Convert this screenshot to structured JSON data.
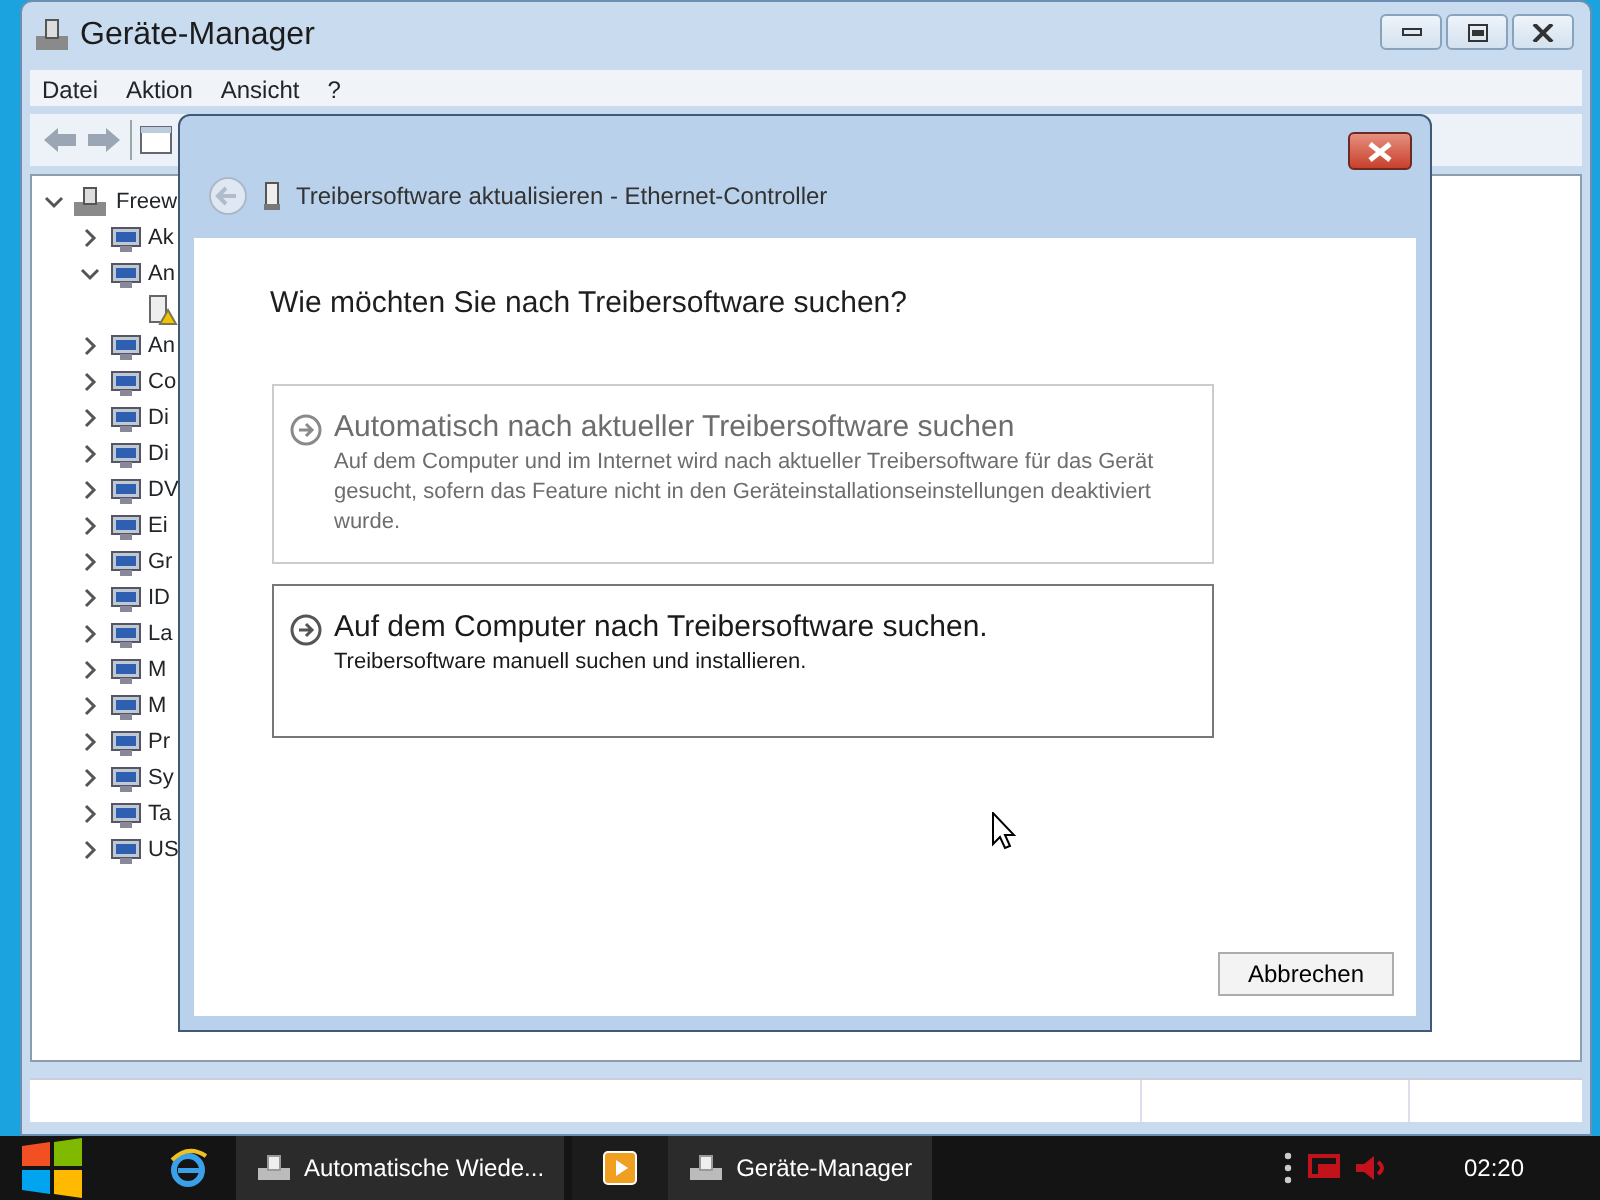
{
  "main_window": {
    "title": "Geräte-Manager",
    "menu": [
      "Datei",
      "Aktion",
      "Ansicht",
      "?"
    ],
    "tree": [
      {
        "label": "Freew",
        "expanded": true,
        "children": [
          {
            "label": "Ak",
            "expanded": false
          },
          {
            "label": "An",
            "expanded": true,
            "children": [
              {
                "kind": "warning"
              }
            ]
          },
          {
            "label": "An",
            "expanded": false
          },
          {
            "label": "Co",
            "expanded": false
          },
          {
            "label": "Di",
            "expanded": false
          },
          {
            "label": "Di",
            "expanded": false
          },
          {
            "label": "DV",
            "expanded": false
          },
          {
            "label": "Ei",
            "expanded": false
          },
          {
            "label": "Gr",
            "expanded": false
          },
          {
            "label": "ID",
            "expanded": false
          },
          {
            "label": "La",
            "expanded": false
          },
          {
            "label": "M",
            "expanded": false
          },
          {
            "label": "M",
            "expanded": false
          },
          {
            "label": "Pr",
            "expanded": false
          },
          {
            "label": "Sy",
            "expanded": false
          },
          {
            "label": "Ta",
            "expanded": false
          },
          {
            "label": "US",
            "expanded": false
          }
        ]
      }
    ]
  },
  "dialog": {
    "title": "Treibersoftware aktualisieren - Ethernet-Controller",
    "heading": "Wie möchten Sie nach Treibersoftware suchen?",
    "options": [
      {
        "title": "Automatisch nach aktueller Treibersoftware suchen",
        "description": "Auf dem Computer und im Internet wird nach aktueller Treibersoftware für das Gerät gesucht, sofern das Feature nicht in den Geräteinstallationseinstellungen deaktiviert wurde.",
        "disabled": true
      },
      {
        "title": "Auf dem Computer nach Treibersoftware suchen.",
        "description": "Treibersoftware manuell suchen und installieren.",
        "disabled": false
      }
    ],
    "cancel": "Abbrechen"
  },
  "taskbar": {
    "tasks": [
      {
        "kind": "browser"
      },
      {
        "kind": "labeled",
        "label": "Automatische Wiede..."
      },
      {
        "kind": "media"
      },
      {
        "kind": "labeled",
        "label": "Geräte-Manager"
      }
    ],
    "clock": "02:20"
  }
}
